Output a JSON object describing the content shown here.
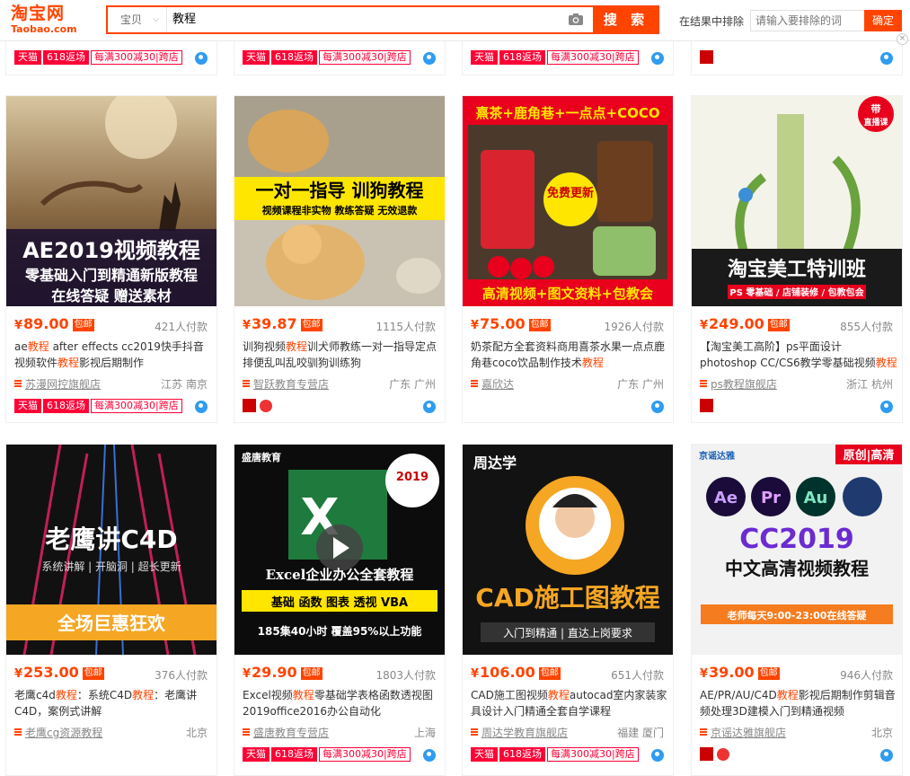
{
  "header": {
    "logo_cn": "淘宝网",
    "logo_en": "Taobao.com",
    "category": "宝贝",
    "query": "教程",
    "search_label": "搜 索",
    "exclude_label": "在结果中排除",
    "exclude_placeholder": "请输入要排除的词",
    "exclude_confirm": "确定",
    "close_glyph": "×"
  },
  "tags": {
    "tmall": "天猫",
    "event": "618返场",
    "promo": "每满300减30",
    "cross": "跨店"
  },
  "baoyou": "包邮",
  "currency": "¥",
  "products": [
    {
      "price": "89.00",
      "deal": "421人付款",
      "title_parts": [
        "ae",
        "教程",
        " after effects cc2019快手抖音视频软件",
        "教程",
        "影视后期制作"
      ],
      "shop": "苏漫网控旗舰店",
      "loc": "江苏 南京",
      "image_text": [
        "AE2019视频教程",
        "零基础入门到精通新版教程",
        "在线答疑 赠送素材"
      ]
    },
    {
      "price": "39.87",
      "deal": "1115人付款",
      "title_parts": [
        "训狗视频",
        "教程",
        "训犬师教练一对一指导定点排便乱叫乱咬驯狗训练狗",
        "",
        ""
      ],
      "shop": "智跃教育专营店",
      "loc": "广东 广州",
      "image_text": [
        "一对一指导  训狗教程",
        "视频课程非实物 教练答疑 无效退款",
        ""
      ]
    },
    {
      "price": "75.00",
      "deal": "1926人付款",
      "title_parts": [
        "奶茶配方全套资料商用喜茶水果一点点鹿角巷coco饮品制作技术",
        "教程",
        "",
        "",
        ""
      ],
      "shop": "嘉欣达",
      "loc": "广东 广州",
      "image_text": [
        "熹茶+鹿角巷+一点点+COCO",
        "免费更新",
        "高清视频+图文资料+包教会"
      ]
    },
    {
      "price": "249.00",
      "deal": "855人付款",
      "title_parts": [
        "【淘宝美工高阶】ps平面设计photoshop CC/CS6教学零基础视频",
        "教程",
        "",
        "",
        ""
      ],
      "shop": "ps教程旗舰店",
      "loc": "浙江 杭州",
      "image_text": [
        "淘宝美工特训班",
        "PS 零基础 / 店铺装修 / 包教包会",
        "带直播课"
      ]
    },
    {
      "price": "253.00",
      "deal": "376人付款",
      "title_parts": [
        "老鹰c4d",
        "教程",
        "：系统C4D",
        "教程",
        "：老鹰讲C4D，案例式讲解"
      ],
      "shop": "老鹰cg资源教程",
      "loc": "北京",
      "image_text": [
        "老鹰讲C4D",
        "系统讲解 | 开脑洞 | 超长更新",
        "全场巨惠狂欢"
      ]
    },
    {
      "price": "29.90",
      "deal": "1803人付款",
      "title_parts": [
        "Excel视频",
        "教程",
        "零基础学表格函数透视图2019office2016办公自动化",
        "",
        ""
      ],
      "shop": "盛唐教育专营店",
      "loc": "上海",
      "image_text": [
        "Excel企业办公全套教程",
        "基础 函数 图表 透视 VBA",
        "185集40小时  覆盖95%以上功能"
      ]
    },
    {
      "price": "106.00",
      "deal": "651人付款",
      "title_parts": [
        "CAD施工图视频",
        "教程",
        "autocad室内家装家具设计入门精通全套自学课程",
        "",
        ""
      ],
      "shop": "周达学教育旗舰店",
      "loc": "福建 厦门",
      "image_text": [
        "周达学",
        "CAD施工图教程",
        "入门到精通 | 直达上岗要求"
      ]
    },
    {
      "price": "39.00",
      "deal": "946人付款",
      "title_parts": [
        "AE/PR/AU/C4D",
        "教程",
        "影视后期制作剪辑音频处理3D建模入门到精通视频",
        "",
        ""
      ],
      "shop": "京谣达雅旗舰店",
      "loc": "北京",
      "image_text": [
        "CC2019",
        "中文高清视频教程",
        "老师每天9:00-23:00在线答疑"
      ]
    }
  ]
}
